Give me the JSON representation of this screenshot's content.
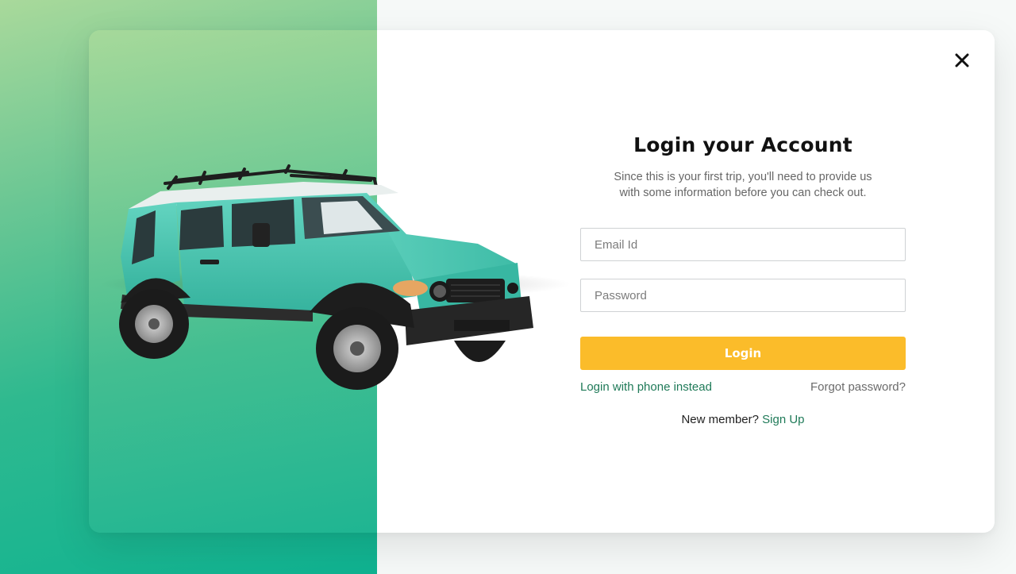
{
  "modal": {
    "title": "Login your Account",
    "subtitle_line1": "Since this is your first trip, you'll need to provide us",
    "subtitle_line2": "with some information before you can check out.",
    "close_icon": "close-icon"
  },
  "form": {
    "email_placeholder": "Email Id",
    "password_placeholder": "Password",
    "login_label": "Login"
  },
  "links": {
    "phone_login": "Login with phone instead",
    "forgot_password": "Forgot password?",
    "new_member_text": "New member?",
    "sign_up": "Sign Up"
  },
  "colors": {
    "accent_yellow": "#fbbc2a",
    "link_green": "#1f7a58",
    "gradient_start": "#a6d99a",
    "gradient_end": "#1fb592",
    "car_body": "#4fcbb4"
  }
}
